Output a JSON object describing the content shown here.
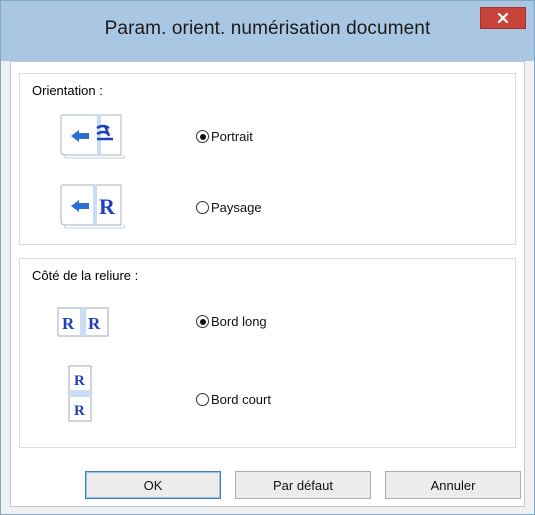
{
  "window": {
    "title": "Param. orient. numérisation document",
    "close_symbol": "×"
  },
  "orientation": {
    "label": "Orientation :",
    "options": [
      {
        "label": "Portrait",
        "checked": true,
        "icon": "portrait-orientation-icon"
      },
      {
        "label": "Paysage",
        "checked": false,
        "icon": "landscape-orientation-icon"
      }
    ]
  },
  "binding": {
    "label": "Côté de la reliure :",
    "options": [
      {
        "label": "Bord long",
        "checked": true,
        "icon": "long-edge-binding-icon"
      },
      {
        "label": "Bord court",
        "checked": false,
        "icon": "short-edge-binding-icon"
      }
    ]
  },
  "buttons": {
    "ok": "OK",
    "default": "Par défaut",
    "cancel": "Annuler"
  },
  "colors": {
    "titlebar": "#a9c6e2",
    "close": "#c7443a",
    "icon_blue": "#1f3fbf",
    "arrow_blue": "#2a6fd6"
  }
}
